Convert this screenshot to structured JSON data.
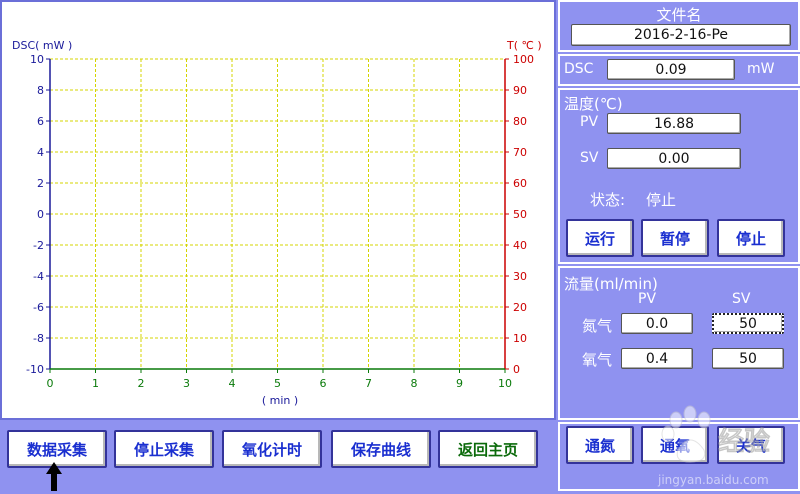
{
  "chart_data": {
    "type": "line",
    "left_axis_label": "DSC( mW )",
    "right_axis_label": "T( ℃ )",
    "x_axis_label": "( min )",
    "x_ticks": [
      "0",
      "1",
      "2",
      "3",
      "4",
      "5",
      "6",
      "7",
      "8",
      "9",
      "10"
    ],
    "y_left_ticks": [
      "10",
      "8",
      "6",
      "4",
      "2",
      "0",
      "-2",
      "-4",
      "-6",
      "-8",
      "-10"
    ],
    "y_right_ticks": [
      "100",
      "90",
      "80",
      "70",
      "60",
      "50",
      "40",
      "30",
      "20",
      "10",
      "0"
    ],
    "xlim": [
      0,
      10
    ],
    "ylim_left": [
      -10,
      10
    ],
    "ylim_right": [
      0,
      100
    ],
    "grid": true,
    "series": [],
    "colors": {
      "left_axis": "#1a1a9a",
      "right_axis": "#cc0000",
      "x_axis": "#0a7a0a",
      "grid": "#d4d400"
    }
  },
  "bottom_buttons": [
    {
      "label": "数据采集",
      "color": "blue"
    },
    {
      "label": "停止采集",
      "color": "blue"
    },
    {
      "label": "氧化计时",
      "color": "blue"
    },
    {
      "label": "保存曲线",
      "color": "blue"
    },
    {
      "label": "返回主页",
      "color": "green"
    }
  ],
  "file": {
    "title": "文件名",
    "value": "2016-2-16-Pe"
  },
  "dsc": {
    "label": "DSC",
    "value": "0.09",
    "unit": "mW"
  },
  "temperature": {
    "title": "温度(℃)",
    "pv_label": "PV",
    "pv_value": "16.88",
    "sv_label": "SV",
    "sv_value": "0.00",
    "status_label": "状态:",
    "status_value": "停止",
    "buttons": [
      "运行",
      "暂停",
      "停止"
    ]
  },
  "flow": {
    "title": "流量(ml/min)",
    "pv_header": "PV",
    "sv_header": "SV",
    "nitrogen_label": "氮气",
    "nitrogen_pv": "0.0",
    "nitrogen_sv": "50",
    "oxygen_label": "氧气",
    "oxygen_pv": "0.4",
    "oxygen_sv": "50",
    "buttons": [
      "通氮",
      "通氧",
      "关气"
    ]
  },
  "watermark": {
    "text": "经验",
    "subtext": "jingyan.baidu.com"
  }
}
